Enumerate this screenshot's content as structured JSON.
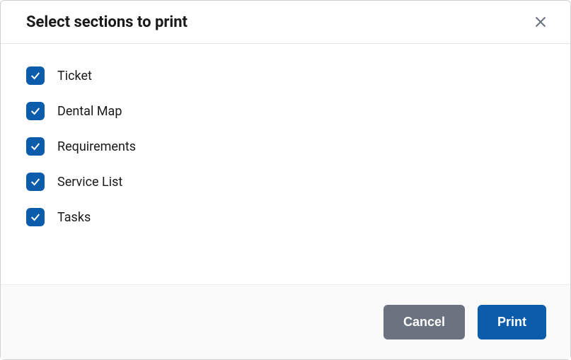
{
  "modal": {
    "title": "Select sections to print",
    "sections": [
      {
        "label": "Ticket",
        "checked": true
      },
      {
        "label": "Dental Map",
        "checked": true
      },
      {
        "label": "Requirements",
        "checked": true
      },
      {
        "label": "Service List",
        "checked": true
      },
      {
        "label": "Tasks",
        "checked": true
      }
    ],
    "footer": {
      "cancel": "Cancel",
      "print": "Print"
    }
  }
}
